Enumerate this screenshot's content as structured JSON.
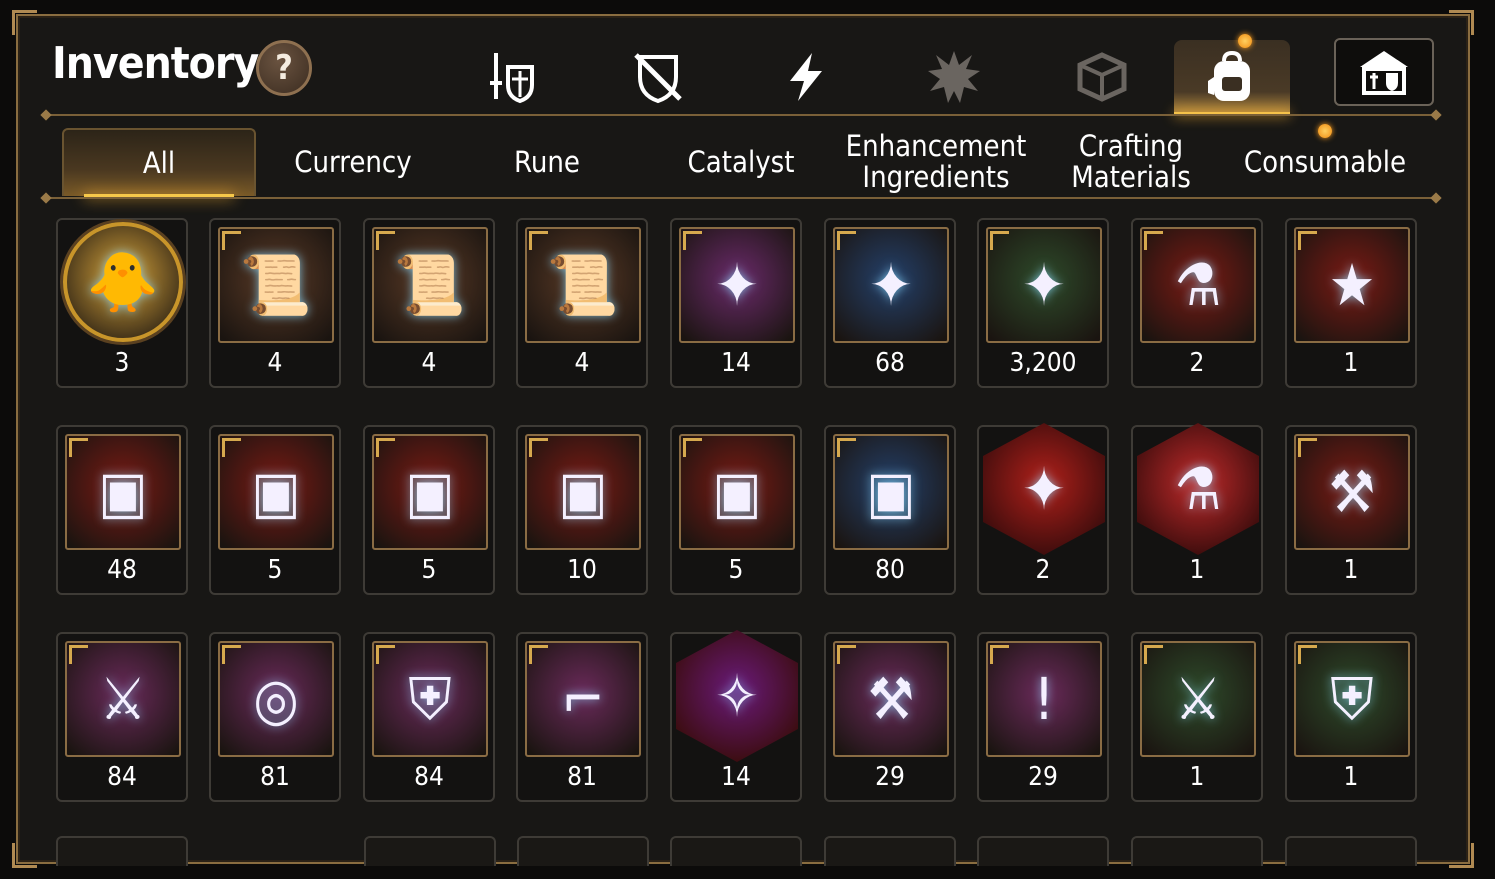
{
  "header": {
    "title": "Inventory",
    "help_label": "?"
  },
  "category_icons": [
    {
      "icon": "sword-shield-icon",
      "active": false
    },
    {
      "icon": "crossed-shield-icon",
      "active": false
    },
    {
      "icon": "lightning-icon",
      "active": false
    },
    {
      "icon": "spiked-emblem-icon",
      "active": false
    },
    {
      "icon": "cube-crest-icon",
      "active": false
    },
    {
      "icon": "backpack-icon",
      "active": true,
      "notification": true
    }
  ],
  "guild_button": {
    "icon": "guild-hall-icon"
  },
  "tabs": [
    {
      "label": "All",
      "active": true
    },
    {
      "label": "Currency"
    },
    {
      "label": "Rune"
    },
    {
      "label": "Catalyst"
    },
    {
      "label": "Enhancement Ingredients"
    },
    {
      "label": "Crafting Materials"
    },
    {
      "label": "Consumable",
      "notification": true
    }
  ],
  "items": [
    {
      "icon": "mascot-portrait-icon",
      "qty": "3",
      "frame": "round",
      "bg": "#d9a53b"
    },
    {
      "icon": "scroll-upgrade-icon",
      "qty": "4",
      "frame": "square",
      "bg": "#5a3a26"
    },
    {
      "icon": "rainbow-scroll-icon",
      "qty": "4",
      "frame": "square",
      "bg": "#5a3a26"
    },
    {
      "icon": "scroll-upgrade-icon",
      "qty": "4",
      "frame": "square",
      "bg": "#5a3a26"
    },
    {
      "icon": "purple-crystal-icon",
      "qty": "14",
      "frame": "square",
      "bg": "#6a2a6a"
    },
    {
      "icon": "gold-crystal-icon",
      "qty": "68",
      "frame": "square",
      "bg": "#24406a"
    },
    {
      "icon": "silver-crystal-icon",
      "qty": "3,200",
      "frame": "square",
      "bg": "#2e4a2a"
    },
    {
      "icon": "red-potion-icon",
      "qty": "2",
      "frame": "square",
      "bg": "#7a1a14"
    },
    {
      "icon": "star-potion-icon",
      "qty": "1",
      "frame": "square",
      "bg": "#7a1a14"
    },
    {
      "icon": "silver-chest-icon",
      "qty": "48",
      "frame": "square",
      "bg": "#7a1a14"
    },
    {
      "icon": "blue-chest-icon",
      "qty": "5",
      "frame": "square",
      "bg": "#7a1a14"
    },
    {
      "icon": "red-chest-icon",
      "qty": "5",
      "frame": "square",
      "bg": "#7a1a14"
    },
    {
      "icon": "gold-treasure-chest-icon",
      "qty": "10",
      "frame": "square",
      "bg": "#7a1a14"
    },
    {
      "icon": "gold-treasure-chest-icon",
      "qty": "5",
      "frame": "square",
      "bg": "#7a1a14"
    },
    {
      "icon": "dark-chest-icon",
      "qty": "80",
      "frame": "square",
      "bg": "#24406a"
    },
    {
      "icon": "red-rune-stone-icon",
      "qty": "2",
      "frame": "hex",
      "bg": "#b0201a"
    },
    {
      "icon": "pink-potion-icon",
      "qty": "1",
      "frame": "hex",
      "bg": "#c02a2a"
    },
    {
      "icon": "blue-hammer-stone-icon",
      "qty": "1",
      "frame": "square",
      "bg": "#7a1a14"
    },
    {
      "icon": "sword-rune-icon",
      "qty": "84",
      "frame": "square",
      "bg": "#6a2a5a"
    },
    {
      "icon": "helmet-rune-icon",
      "qty": "81",
      "frame": "square",
      "bg": "#6a2a5a"
    },
    {
      "icon": "armor-rune-icon",
      "qty": "84",
      "frame": "square",
      "bg": "#6a2a5a"
    },
    {
      "icon": "boot-rune-icon",
      "qty": "81",
      "frame": "square",
      "bg": "#6a2a5a"
    },
    {
      "icon": "star-rune-icon",
      "qty": "14",
      "frame": "hex",
      "bg": "#6a1a7a"
    },
    {
      "icon": "hammer-rune-icon",
      "qty": "29",
      "frame": "square",
      "bg": "#6a2a5a"
    },
    {
      "icon": "exclamation-rune-icon",
      "qty": "29",
      "frame": "square",
      "bg": "#6a2a5a"
    },
    {
      "icon": "sword-tablet-icon",
      "qty": "1",
      "frame": "square",
      "bg": "#2e4a2a"
    },
    {
      "icon": "helmet-tablet-icon",
      "qty": "1",
      "frame": "square",
      "bg": "#2e4a2a"
    }
  ]
}
